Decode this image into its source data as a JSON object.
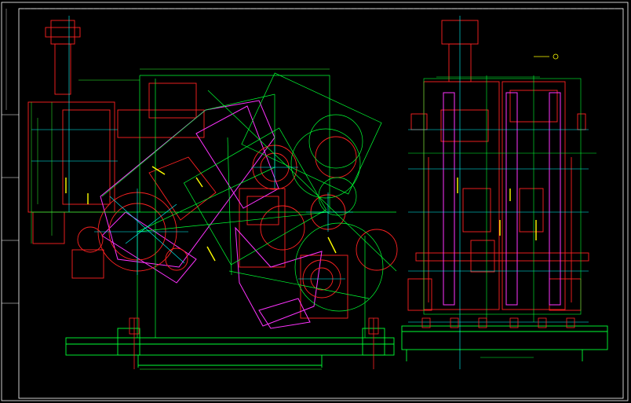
{
  "drawing": {
    "background": "#000000",
    "colors": {
      "frame": "#ffffff",
      "outline": "#ff2222",
      "linkage": "#ff33ff",
      "geometry": "#00ff33",
      "center": "#00ffff",
      "dimension": "#33ff33",
      "annotation": "#ffff00",
      "hidden": "#ff5555"
    },
    "views": [
      "front-elevation",
      "side-elevation"
    ],
    "dimension_labels": [],
    "annotations": []
  }
}
